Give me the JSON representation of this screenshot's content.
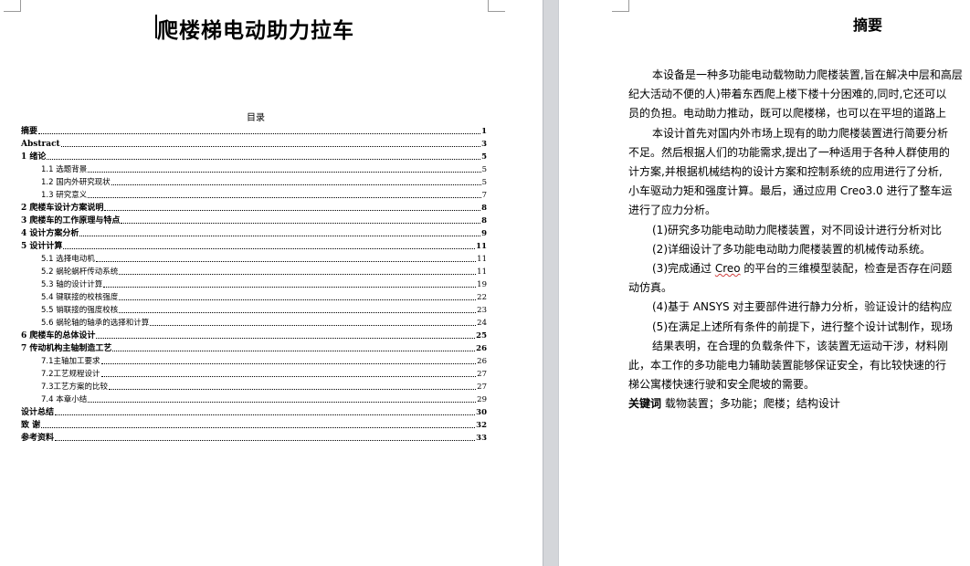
{
  "page1": {
    "title": "爬楼梯电动助力拉车",
    "toc_heading": "目录",
    "toc": [
      {
        "label": "摘要",
        "page": "1",
        "level": 1
      },
      {
        "label": "Abstract",
        "page": "3",
        "level": 1
      },
      {
        "label": "1 绪论",
        "page": "5",
        "level": 1
      },
      {
        "label": "1.1 选题背景",
        "page": "5",
        "level": 2
      },
      {
        "label": "1.2 国内外研究现状",
        "page": "5",
        "level": 2
      },
      {
        "label": "1.3 研究意义",
        "page": "7",
        "level": 2
      },
      {
        "label": "2 爬楼车设计方案说明",
        "page": "8",
        "level": 1
      },
      {
        "label": "3 爬楼车的工作原理与特点",
        "page": "8",
        "level": 1
      },
      {
        "label": "4 设计方案分析",
        "page": "9",
        "level": 1
      },
      {
        "label": "5 设计计算",
        "page": "11",
        "level": 1
      },
      {
        "label": "5.1 选择电动机",
        "page": "11",
        "level": 2
      },
      {
        "label": "5.2 蜗轮蜗杆传动系统",
        "page": "11",
        "level": 2
      },
      {
        "label": "5.3 轴的设计计算",
        "page": "19",
        "level": 2
      },
      {
        "label": "5.4 键联接的校核强度",
        "page": "22",
        "level": 2
      },
      {
        "label": "5.5 销联接的强度校核",
        "page": "23",
        "level": 2
      },
      {
        "label": "5.6 蜗轮轴的轴承的选择和计算",
        "page": "24",
        "level": 2
      },
      {
        "label": "6 爬楼车的总体设计",
        "page": "25",
        "level": 1
      },
      {
        "label": "7 传动机构主轴制造工艺",
        "page": "26",
        "level": 1
      },
      {
        "label": "7.1主轴加工要求",
        "page": "26",
        "level": 2
      },
      {
        "label": "7.2工艺规程设计",
        "page": "27",
        "level": 2
      },
      {
        "label": "7.3工艺方案的比较",
        "page": "27",
        "level": 2
      },
      {
        "label": "7.4 本章小结",
        "page": "29",
        "level": 2
      },
      {
        "label": "设计总结",
        "page": "30",
        "level": 1
      },
      {
        "label": "致 谢",
        "page": "32",
        "level": 1
      },
      {
        "label": "参考资料",
        "page": "33",
        "level": 1
      }
    ]
  },
  "page2": {
    "title": "摘要",
    "paragraphs": [
      {
        "text": "本设备是一种多功能电动载物助力爬楼装置,旨在解决中层和高层",
        "indent": true
      },
      {
        "text": "纪大活动不便的人)带着东西爬上楼下楼十分困难的,同时,它还可以",
        "indent": false
      },
      {
        "text": "员的负担。电动助力推动，既可以爬楼梯，也可以在平坦的道路上",
        "indent": false
      },
      {
        "text": "本设计首先对国内外市场上现有的助力爬楼装置进行简要分析",
        "indent": true
      },
      {
        "text": "不足。然后根据人们的功能需求,提出了一种适用于各种人群使用的",
        "indent": false
      },
      {
        "text": "计方案,并根据机械结构的设计方案和控制系统的应用进行了分析,",
        "indent": false
      },
      {
        "text": "小车驱动力矩和强度计算。最后，通过应用 Creo3.0 进行了整车运",
        "indent": false
      },
      {
        "text": "进行了应力分析。",
        "indent": false
      },
      {
        "text": "(1)研究多功能电动助力爬楼装置，对不同设计进行分析对比",
        "indent": true
      },
      {
        "text": "(2)详细设计了多功能电动助力爬楼装置的机械传动系统。",
        "indent": true
      },
      {
        "text_before": "(3)完成通过 ",
        "squiggle": "Creo",
        "text_after": " 的平台的三维模型装配，检查是否存在问题",
        "indent": true
      },
      {
        "text": "动仿真。",
        "indent": false
      },
      {
        "text": "(4)基于 ANSYS 对主要部件进行静力分析，验证设计的结构应",
        "indent": true
      },
      {
        "text": "(5)在满足上述所有条件的前提下，进行整个设计试制作，现场",
        "indent": true
      },
      {
        "text": "结果表明，在合理的负载条件下，该装置无运动干涉，材料刚",
        "indent": true
      },
      {
        "text": "此，本工作的多功能电力辅助装置能够保证安全，有比较快速的行",
        "indent": false
      },
      {
        "text": "梯公寓楼快速行驶和安全爬坡的需要。",
        "indent": false
      }
    ],
    "keywords_label": "关键词",
    "keywords": "载物装置；多功能；爬楼；结构设计"
  }
}
